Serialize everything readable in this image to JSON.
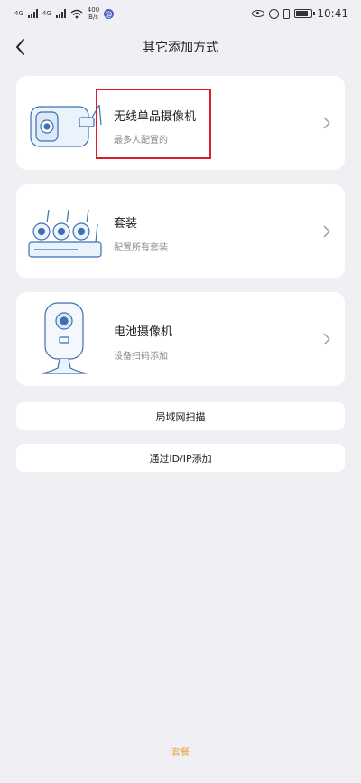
{
  "status_bar": {
    "signal1_label": "4G",
    "signal2_label": "4G",
    "speed_value": "400",
    "speed_unit": "B/s",
    "time": "10:41"
  },
  "header": {
    "title": "其它添加方式"
  },
  "options": [
    {
      "title": "无线单品摄像机",
      "subtitle": "最多人配置的"
    },
    {
      "title": "套装",
      "subtitle": "配置所有套装"
    },
    {
      "title": "电池摄像机",
      "subtitle": "设备扫码添加"
    }
  ],
  "buttons": {
    "lan_scan": "局域网扫描",
    "add_by_id_ip": "通过ID/IP添加"
  },
  "footer": {
    "link_label": "套餐"
  },
  "colors": {
    "background": "#f0eff4",
    "card": "#ffffff",
    "highlight": "#d81e2b",
    "accent": "#e8a33b",
    "illustration": "#3d6fb3"
  }
}
